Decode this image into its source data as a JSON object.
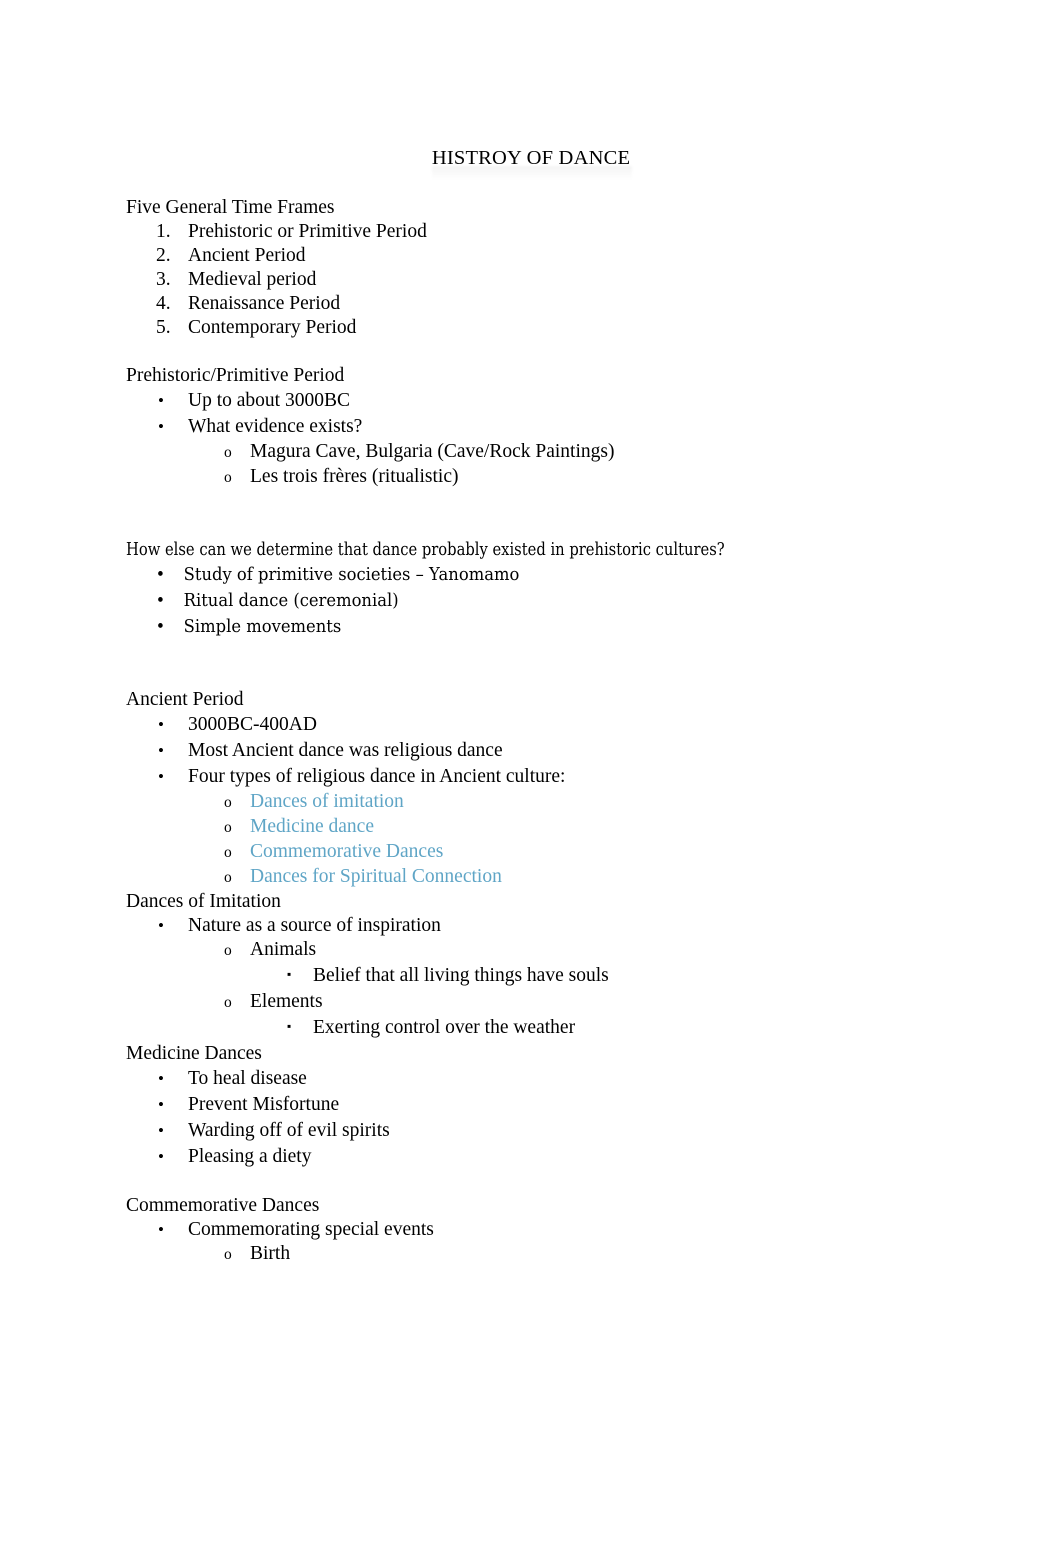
{
  "document": {
    "title": "HISTROY OF DANCE",
    "accent_color": "#5FA5C6",
    "text_color": "#000000",
    "background_color": "#ffffff"
  },
  "markers": {
    "bullet": "•",
    "circle": "o",
    "square": "▪"
  },
  "sections": {
    "time_frames": {
      "heading": "Five General Time Frames",
      "items": [
        {
          "num": "1.",
          "label": "Prehistoric or Primitive Period"
        },
        {
          "num": "2.",
          "label": "Ancient Period"
        },
        {
          "num": "3.",
          "label": "Medieval period"
        },
        {
          "num": "4.",
          "label": "Renaissance Period"
        },
        {
          "num": "5.",
          "label": "Contemporary Period"
        }
      ]
    },
    "prehistoric": {
      "heading": "Prehistoric/Primitive Period",
      "b1": "Up to about 3000BC",
      "b2": "What evidence exists?",
      "b2_sub1": "Magura Cave, Bulgaria (Cave/Rock Paintings)",
      "b2_sub2": "Les trois frères (ritualistic)"
    },
    "how_else": {
      "heading": "How else can we determine that dance probably existed in prehistoric cultures?",
      "b1": "Study of primitive societies – Yanomamo",
      "b2": "Ritual dance (ceremonial)",
      "b3": "Simple movements"
    },
    "ancient": {
      "heading": "Ancient Period",
      "b1": "3000BC-400AD",
      "b2": "Most Ancient dance was religious dance",
      "b3": "Four types of religious dance in Ancient culture:",
      "types": [
        "Dances of imitation",
        "Medicine dance",
        "Commemorative Dances",
        "Dances for Spiritual Connection"
      ]
    },
    "imitation": {
      "heading": "Dances of Imitation",
      "b1": "Nature as a source of inspiration",
      "sub1": "Animals",
      "sub1_a": "Belief that all living things have souls",
      "sub2": "Elements",
      "sub2_a": "Exerting control over the weather"
    },
    "medicine": {
      "heading": "Medicine Dances",
      "b1": "To heal disease",
      "b2": "Prevent Misfortune",
      "b3": "Warding off of evil spirits",
      "b4": "Pleasing a diety"
    },
    "commemorative": {
      "heading": "Commemorative Dances",
      "b1": "Commemorating special events",
      "sub1": "Birth"
    }
  }
}
